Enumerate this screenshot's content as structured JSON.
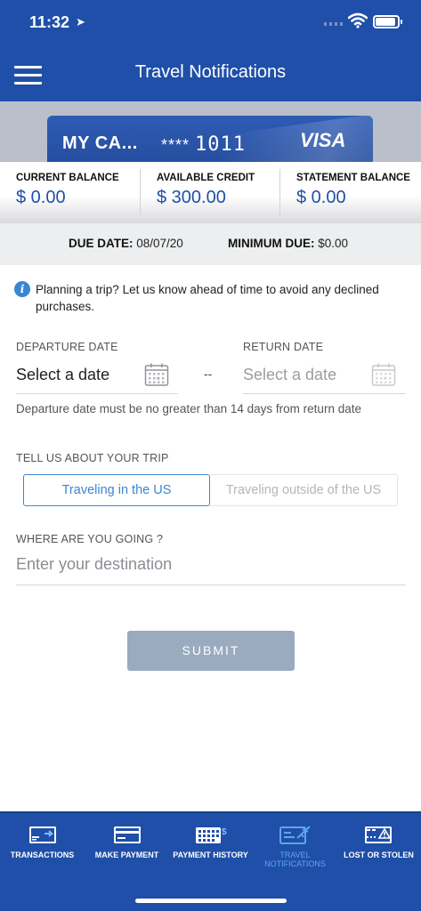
{
  "status": {
    "time": "11:32"
  },
  "header": {
    "title": "Travel Notifications"
  },
  "card": {
    "name": "MY CA...",
    "mask": "****",
    "last4": "1011",
    "brand": "VISA"
  },
  "balances": [
    {
      "label": "CURRENT BALANCE",
      "value": "$ 0.00"
    },
    {
      "label": "AVAILABLE CREDIT",
      "value": "$ 300.00"
    },
    {
      "label": "STATEMENT BALANCE",
      "value": "$ 0.00"
    }
  ],
  "due": {
    "due_date_label": "DUE DATE:",
    "due_date_value": "08/07/20",
    "min_due_label": "MINIMUM DUE:",
    "min_due_value": "$0.00"
  },
  "info": {
    "text": "Planning a trip? Let us know ahead of time to avoid any declined purchases."
  },
  "dates": {
    "departure_label": "DEPARTURE DATE",
    "departure_value": "Select a date",
    "return_label": "RETURN DATE",
    "return_value": "Select a date",
    "separator": "--",
    "hint": "Departure date must be no greater than 14 days from return date"
  },
  "trip": {
    "label": "TELL US ABOUT YOUR TRIP",
    "options": [
      "Traveling in the US",
      "Traveling outside of the US"
    ],
    "selected": "Traveling in the US"
  },
  "destination": {
    "label": "WHERE ARE YOU GOING ?",
    "placeholder": "Enter your destination",
    "value": ""
  },
  "submit_label": "SUBMIT",
  "tabs": [
    {
      "label": "TRANSACTIONS",
      "icon": "transactions-icon"
    },
    {
      "label": "MAKE PAYMENT",
      "icon": "make-payment-icon"
    },
    {
      "label": "PAYMENT HISTORY",
      "icon": "payment-history-icon"
    },
    {
      "label": "TRAVEL NOTIFICATIONS",
      "icon": "travel-notifications-icon",
      "active": true
    },
    {
      "label": "LOST OR STOLEN",
      "icon": "lost-stolen-icon"
    }
  ],
  "colors": {
    "brand": "#1f4fa8",
    "accent": "#3a86d4",
    "submit_disabled": "#9aaabf"
  }
}
